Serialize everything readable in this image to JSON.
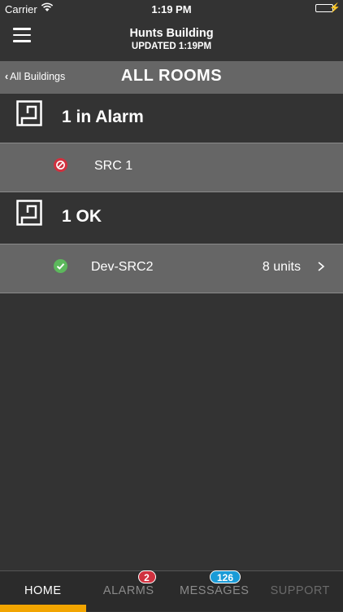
{
  "status_bar": {
    "carrier": "Carrier",
    "time": "1:19 PM"
  },
  "nav": {
    "title": "Hunts Building",
    "subtitle": "UPDATED 1:19PM"
  },
  "sub_header": {
    "back_label": "All Buildings",
    "title": "ALL ROOMS"
  },
  "groups": [
    {
      "label": "1 in Alarm",
      "rows": [
        {
          "name": "SRC 1",
          "status": "alarm",
          "units": ""
        }
      ]
    },
    {
      "label": "1 OK",
      "rows": [
        {
          "name": "Dev-SRC2",
          "status": "ok",
          "units": "8 units"
        }
      ]
    }
  ],
  "tabs": [
    {
      "label": "HOME",
      "active": true,
      "badge": ""
    },
    {
      "label": "ALARMS",
      "active": false,
      "badge": "2"
    },
    {
      "label": "MESSAGES",
      "active": false,
      "badge": "126"
    },
    {
      "label": "SUPPORT",
      "active": false,
      "badge": ""
    }
  ],
  "colors": {
    "background": "#333333",
    "row_background": "#666666",
    "alarm": "#d0313f",
    "ok": "#5cb85c",
    "active_tab_accent": "#f2a500",
    "messages_badge": "#1a9bd7"
  }
}
